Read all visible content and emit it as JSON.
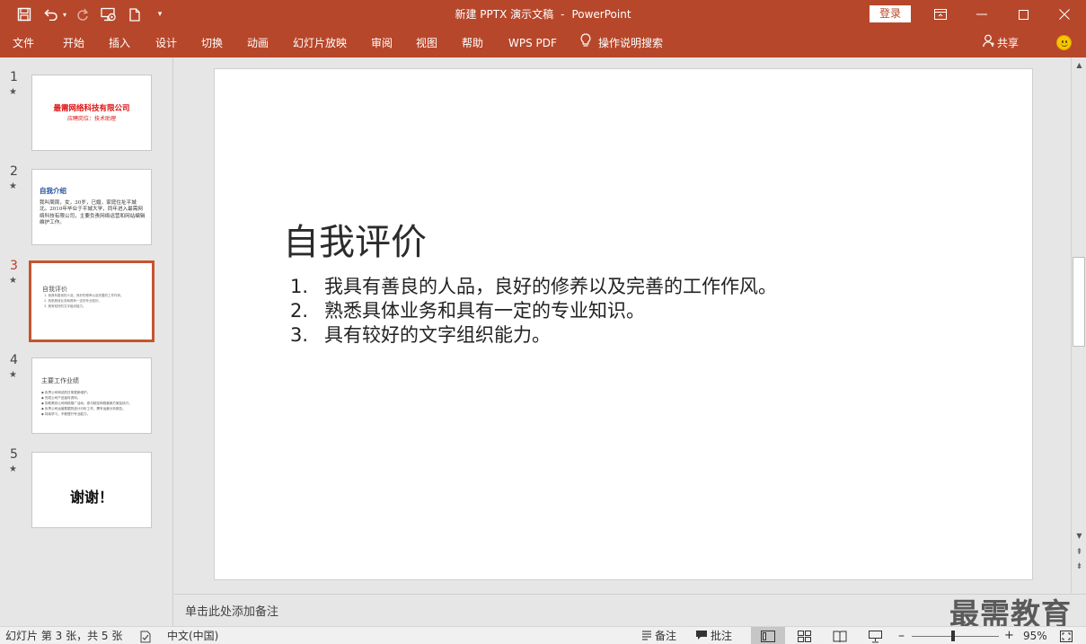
{
  "titlebar": {
    "doc_name": "新建 PPTX 演示文稿",
    "separator": "-",
    "app_name": "PowerPoint",
    "login_label": "登录"
  },
  "ribbon": {
    "tabs": [
      "文件",
      "开始",
      "插入",
      "设计",
      "切换",
      "动画",
      "幻灯片放映",
      "审阅",
      "视图",
      "帮助",
      "WPS PDF"
    ],
    "search_label": "操作说明搜索",
    "share_label": "共享"
  },
  "thumbnails": [
    {
      "number": "1",
      "title": "最需网络科技有限公司",
      "subtitle": "应聘岗位：技术助理"
    },
    {
      "number": "2",
      "title": "自我介绍",
      "body": "我叫周周，女，30岁，已婚，家庭住址平城北。2010年毕业于平城大学，同年进入最需网络科技有限公司，主要负责网络运营和网站编辑维护工作。"
    },
    {
      "number": "3",
      "title": "自我评价",
      "lines": [
        "1. 我具有善良的人品，良好的修养以及完善的工作作风。",
        "2. 熟悉具体业务和具有一定的专业知识。",
        "3. 具有较好的文字组织能力。"
      ]
    },
    {
      "number": "4",
      "title": "主要工作业绩",
      "lines": [
        "◆ 负责公司网站的日常更新维护。",
        "◆ 完成公司产品宣传资料。",
        "◆ 协助策划公司网络推广活动，参与制定网络营销方案及执行。",
        "◆ 负责公司运营数据的统计分析工作，撰写运营分析报告。",
        "◆ 持续学习，不断提升专业能力。"
      ]
    },
    {
      "number": "5",
      "title": "谢谢！"
    }
  ],
  "slide": {
    "title": "自我评价",
    "bullets": [
      {
        "num": "1.",
        "text": "我具有善良的人品，良好的修养以及完善的工作作风。"
      },
      {
        "num": "2.",
        "text": "熟悉具体业务和具有一定的专业知识。"
      },
      {
        "num": "3.",
        "text": "具有较好的文字组织能力。"
      }
    ]
  },
  "notes_placeholder": "单击此处添加备注",
  "watermark": "最需教育",
  "statusbar": {
    "slide_info": "幻灯片 第 3 张，共 5 张",
    "language": "中文(中国)",
    "notes_label": "备注",
    "comments_label": "批注",
    "zoom": "95%"
  },
  "colors": {
    "accent": "#b7472a",
    "selected_thumb_border": "#c4552f"
  },
  "icons": [
    "save-icon",
    "undo-icon",
    "redo-icon",
    "slideshow-from-start-icon",
    "new-document-icon",
    "customize-toolbar-icon",
    "ribbon-display-icon",
    "minimize-icon",
    "maximize-icon",
    "close-icon",
    "lightbulb-icon",
    "person-icon",
    "smiley-icon",
    "star-icon",
    "notes-icon",
    "comments-icon",
    "normal-view-icon",
    "slide-sorter-icon",
    "reading-view-icon",
    "presenter-view-icon",
    "fit-to-window-icon"
  ]
}
